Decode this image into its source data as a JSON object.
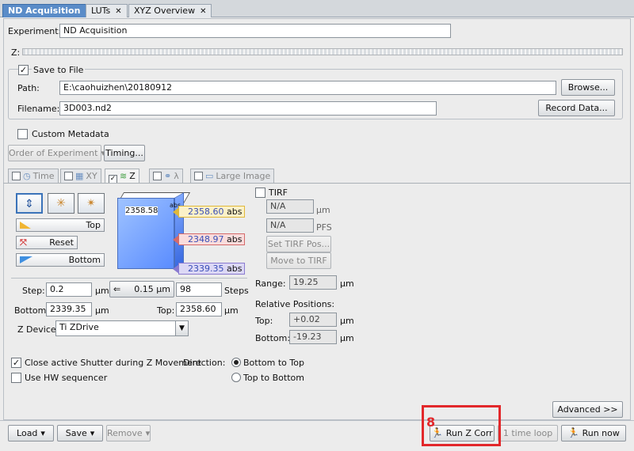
{
  "tabs": [
    {
      "label": "ND Acquisition",
      "active": true
    },
    {
      "label": "LUTs",
      "active": false
    },
    {
      "label": "XYZ Overview",
      "active": false
    }
  ],
  "experiment": {
    "label": "Experiment:",
    "value": "ND Acquisition"
  },
  "z_label": "Z:",
  "save_to_file": {
    "label": "Save to File",
    "checked": true,
    "path_label": "Path:",
    "path_value": "E:\\caohuizhen\\20180912",
    "browse_label": "Browse...",
    "filename_label": "Filename:",
    "filename_value": "3D003.nd2",
    "record_label": "Record Data..."
  },
  "custom_metadata": {
    "label": "Custom Metadata",
    "checked": false
  },
  "order_label": "Order of Experiment",
  "timing_label": "Timing...",
  "subtabs": [
    {
      "label": "Time",
      "checked": false
    },
    {
      "label": "XY",
      "checked": false
    },
    {
      "label": "Z",
      "checked": true
    },
    {
      "label": "λ",
      "checked": false
    },
    {
      "label": "Large Image",
      "checked": false
    }
  ],
  "zpanel": {
    "top_label": "Top",
    "reset_label": "Reset",
    "bottom_label": "Bottom",
    "cube_top_value": "2358.58",
    "cube_abs_small": "abs",
    "marker_top": "2358.60",
    "marker_mid": "2348.97",
    "marker_bottom": "2339.35",
    "abs_label": "abs"
  },
  "tirf": {
    "label": "TIRF",
    "value1": "N/A",
    "unit1": "µm",
    "value2": "N/A",
    "unit2": "PFS",
    "set_pos_label": "Set TIRF Pos...",
    "move_label": "Move to TIRF"
  },
  "step": {
    "label": "Step:",
    "value": "0.2",
    "unit": "µm",
    "range_button": "0.15 µm",
    "steps_value": "98",
    "steps_label": "Steps"
  },
  "bottom": {
    "label": "Bottom:",
    "value": "2339.35",
    "unit": "µm"
  },
  "top": {
    "label": "Top:",
    "value": "2358.60",
    "unit": "µm"
  },
  "range": {
    "label": "Range:",
    "value": "19.25",
    "unit": "µm"
  },
  "relative": {
    "label": "Relative Positions:",
    "top_label": "Top:",
    "top_value": "+0.02",
    "bottom_label": "Bottom:",
    "bottom_value": "-19.23",
    "unit": "µm"
  },
  "z_device": {
    "label": "Z Device:",
    "value": "Ti ZDrive"
  },
  "close_shutter": {
    "label": "Close active Shutter during Z Movement",
    "checked": true
  },
  "hw_sequencer": {
    "label": "Use HW sequencer",
    "checked": false
  },
  "direction": {
    "label": "Direction:",
    "option1": "Bottom to Top",
    "option2": "Top to Bottom",
    "selected": "Bottom to Top"
  },
  "advanced_label": "Advanced >>",
  "footer": {
    "load": "Load",
    "save": "Save",
    "remove": "Remove",
    "run_z_corr": "Run Z Corr",
    "one_time_loop": "1 time loop",
    "run_now": "Run now"
  },
  "annotation_number": "8",
  "colors": {
    "tab_active": "#5a8cc8",
    "highlight_red": "#e2282b",
    "marker_top": "#f2d35a",
    "marker_mid": "#e07a7a",
    "marker_bottom": "#9a88d8"
  }
}
